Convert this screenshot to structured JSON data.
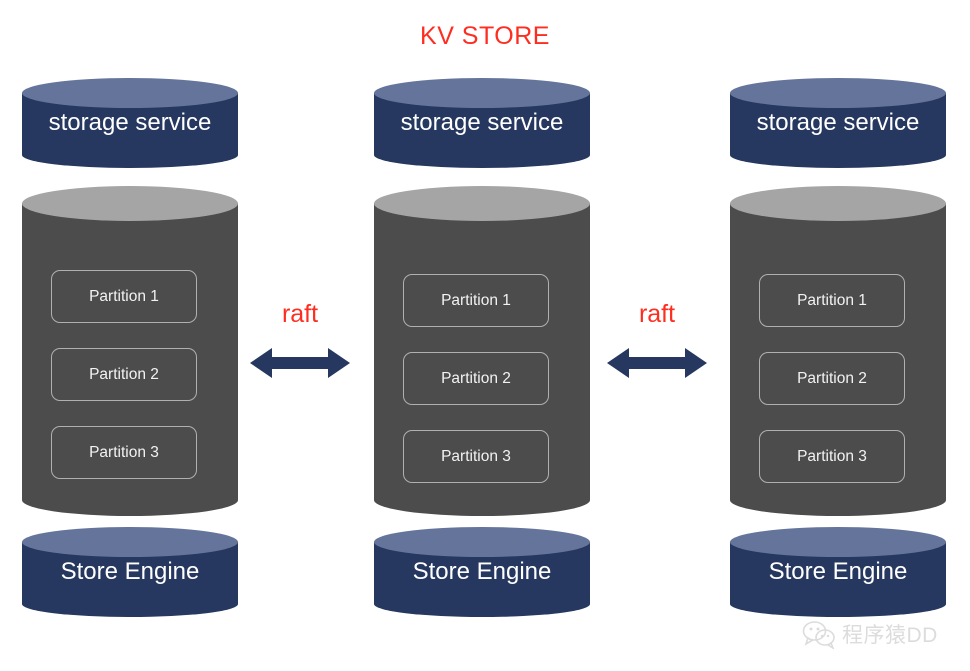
{
  "title": "KV STORE",
  "theme": {
    "title_color": "#ff2d20",
    "navy_body": "#26385f",
    "navy_top": "#64749a",
    "gray_body": "#4c4c4c",
    "gray_top": "#a5a5a5",
    "partition_border": "#b0b0b0",
    "partition_text": "#f2f2f2",
    "arrow_color": "#26385f",
    "raft_label_color": "#ff2d20",
    "background": "#ffffff"
  },
  "nodes": [
    {
      "id": "node-1",
      "storage_service_label": "storage service",
      "store_engine_label": "Store Engine",
      "partitions": [
        "Partition 1",
        "Partition 2",
        "Partition 3"
      ]
    },
    {
      "id": "node-2",
      "storage_service_label": "storage service",
      "store_engine_label": "Store Engine",
      "partitions": [
        "Partition 1",
        "Partition 2",
        "Partition 3"
      ]
    },
    {
      "id": "node-3",
      "storage_service_label": "storage service",
      "store_engine_label": "Store Engine",
      "partitions": [
        "Partition 1",
        "Partition 2",
        "Partition 3"
      ]
    }
  ],
  "connectors": [
    {
      "id": "raft-1",
      "label": "raft",
      "icon": "double-headed-arrow"
    },
    {
      "id": "raft-2",
      "label": "raft",
      "icon": "double-headed-arrow"
    }
  ],
  "watermark": {
    "text": "程序猿DD",
    "icon": "wechat-icon"
  }
}
